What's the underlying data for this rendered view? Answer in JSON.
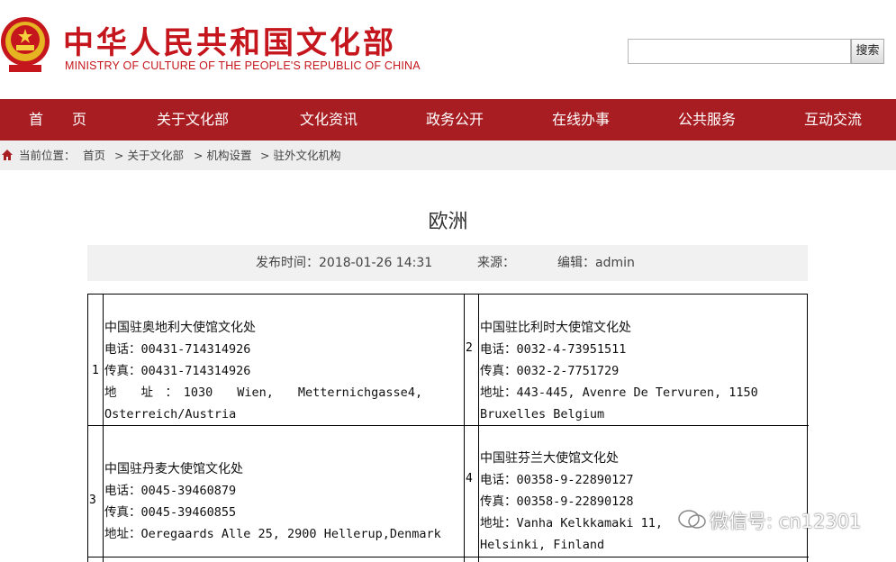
{
  "header": {
    "title_cn": "中华人民共和国文化部",
    "title_en": "MINISTRY OF CULTURE OF THE PEOPLE'S REPUBLIC OF CHINA",
    "search_placeholder": "",
    "search_button": "搜索"
  },
  "nav": {
    "items": [
      "首　　页",
      "关于文化部",
      "文化资讯",
      "政务公开",
      "在线办事",
      "公共服务",
      "互动交流"
    ]
  },
  "breadcrumb": {
    "label": "当前位置：",
    "items": [
      "首页",
      "> 关于文化部",
      "> 机构设置",
      "> 驻外文化机构"
    ]
  },
  "article": {
    "title": "欧洲",
    "publish_time": "发布时间：2018-01-26 14:31",
    "source": "来源：",
    "editor": "编辑：admin"
  },
  "entries": [
    {
      "index": "1",
      "name": "中国驻奥地利大使馆文化处",
      "phone": "电话：00431-714314926",
      "fax": "传真：00431-714314926",
      "address_line1": "地　　址　：　1030　　Wien,　　Metternichgasse4,",
      "address_line2": "Osterreich/Austria"
    },
    {
      "index": "2",
      "name": "中国驻比利时大使馆文化处",
      "phone": "电话：0032-4-73951511",
      "fax": "传真：0032-2-7751729",
      "address_line1": "地址：443-445, Avenre De Tervuren,  1150",
      "address_line2": "Bruxelles Belgium"
    },
    {
      "index": "3",
      "name": "中国驻丹麦大使馆文化处",
      "phone": "电话：0045-39460879",
      "fax": "传真：0045-39460855",
      "address_line1": "地址：Oeregaards Alle 25, 2900 Hellerup,Denmark",
      "address_line2": ""
    },
    {
      "index": "4",
      "name": "中国驻芬兰大使馆文化处",
      "phone": "电话：00358-9-22890127",
      "fax": "传真：00358-9-22890128",
      "address_line1": "地址：Vanha Kelkkamaki 11,",
      "address_line2": "Helsinki, Finland"
    }
  ],
  "watermark": {
    "text": "微信号: cn12301"
  },
  "colors": {
    "brand_red": "#c4161c",
    "nav_bg": "#a81d22",
    "crumb_bg": "#eeeeee"
  }
}
